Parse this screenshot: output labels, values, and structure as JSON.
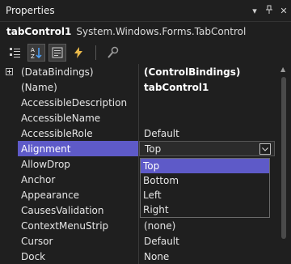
{
  "panel": {
    "title": "Properties"
  },
  "object": {
    "name": "tabControl1",
    "type": "System.Windows.Forms.TabControl"
  },
  "properties": [
    {
      "name": "(DataBindings)",
      "value": "(ControlBindings)"
    },
    {
      "name": "(Name)",
      "value": "tabControl1"
    },
    {
      "name": "AccessibleDescription",
      "value": ""
    },
    {
      "name": "AccessibleName",
      "value": ""
    },
    {
      "name": "AccessibleRole",
      "value": "Default"
    },
    {
      "name": "Alignment",
      "value": "Top"
    },
    {
      "name": "AllowDrop",
      "value": ""
    },
    {
      "name": "Anchor",
      "value": ""
    },
    {
      "name": "Appearance",
      "value": ""
    },
    {
      "name": "CausesValidation",
      "value": ""
    },
    {
      "name": "ContextMenuStrip",
      "value": "(none)"
    },
    {
      "name": "Cursor",
      "value": "Default"
    },
    {
      "name": "Dock",
      "value": "None"
    }
  ],
  "dropdown": {
    "options": [
      "Top",
      "Bottom",
      "Left",
      "Right"
    ],
    "highlighted": "Top"
  },
  "colors": {
    "selection": "#5e5ac8",
    "background": "#1f1f1f"
  }
}
